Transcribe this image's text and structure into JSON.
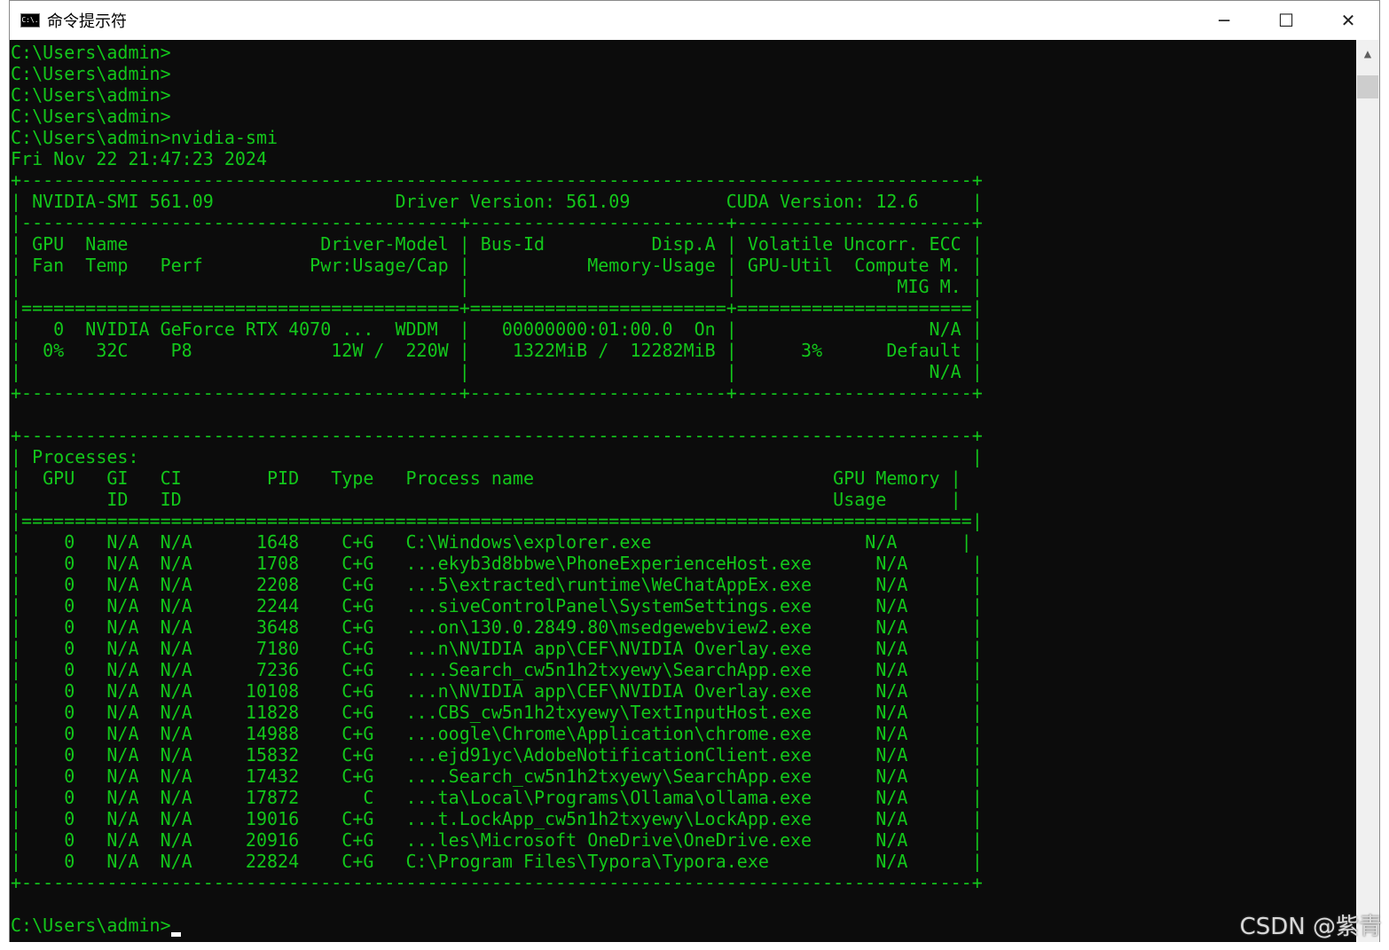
{
  "window": {
    "title": "命令提示符",
    "icon_text": "C:\\.",
    "minimize_glyph": "─",
    "maximize_glyph": "☐",
    "close_glyph": "✕"
  },
  "console": {
    "lines": [
      "C:\\Users\\admin>",
      "C:\\Users\\admin>",
      "C:\\Users\\admin>",
      "C:\\Users\\admin>",
      "C:\\Users\\admin>nvidia-smi",
      "Fri Nov 22 21:47:23 2024",
      "+-----------------------------------------------------------------------------------------+",
      "| NVIDIA-SMI 561.09                 Driver Version: 561.09         CUDA Version: 12.6     |",
      "|-----------------------------------------+------------------------+----------------------+",
      "| GPU  Name                  Driver-Model | Bus-Id          Disp.A | Volatile Uncorr. ECC |",
      "| Fan  Temp   Perf          Pwr:Usage/Cap |           Memory-Usage | GPU-Util  Compute M. |",
      "|                                         |                        |               MIG M. |",
      "|=========================================+========================+======================|",
      "|   0  NVIDIA GeForce RTX 4070 ...  WDDM  |   00000000:01:00.0  On |                  N/A |",
      "|  0%   32C    P8             12W /  220W |    1322MiB /  12282MiB |      3%      Default |",
      "|                                         |                        |                  N/A |",
      "+-----------------------------------------+------------------------+----------------------+",
      "",
      "+-----------------------------------------------------------------------------------------+",
      "| Processes:                                                                              |",
      "|  GPU   GI   CI        PID   Type   Process name                            GPU Memory |",
      "|        ID   ID                                                             Usage      |",
      "|=========================================================================================|",
      "|    0   N/A  N/A      1648    C+G   C:\\Windows\\explorer.exe                    N/A      |",
      "|    0   N/A  N/A      1708    C+G   ...ekyb3d8bbwe\\PhoneExperienceHost.exe      N/A      |",
      "|    0   N/A  N/A      2208    C+G   ...5\\extracted\\runtime\\WeChatAppEx.exe      N/A      |",
      "|    0   N/A  N/A      2244    C+G   ...siveControlPanel\\SystemSettings.exe      N/A      |",
      "|    0   N/A  N/A      3648    C+G   ...on\\130.0.2849.80\\msedgewebview2.exe      N/A      |",
      "|    0   N/A  N/A      7180    C+G   ...n\\NVIDIA app\\CEF\\NVIDIA Overlay.exe      N/A      |",
      "|    0   N/A  N/A      7236    C+G   ....Search_cw5n1h2txyewy\\SearchApp.exe      N/A      |",
      "|    0   N/A  N/A     10108    C+G   ...n\\NVIDIA app\\CEF\\NVIDIA Overlay.exe      N/A      |",
      "|    0   N/A  N/A     11828    C+G   ...CBS_cw5n1h2txyewy\\TextInputHost.exe      N/A      |",
      "|    0   N/A  N/A     14988    C+G   ...oogle\\Chrome\\Application\\chrome.exe      N/A      |",
      "|    0   N/A  N/A     15832    C+G   ...ejd91yc\\AdobeNotificationClient.exe      N/A      |",
      "|    0   N/A  N/A     17432    C+G   ....Search_cw5n1h2txyewy\\SearchApp.exe      N/A      |",
      "|    0   N/A  N/A     17872      C   ...ta\\Local\\Programs\\Ollama\\ollama.exe      N/A      |",
      "|    0   N/A  N/A     19016    C+G   ...t.LockApp_cw5n1h2txyewy\\LockApp.exe      N/A      |",
      "|    0   N/A  N/A     20916    C+G   ...les\\Microsoft OneDrive\\OneDrive.exe      N/A      |",
      "|    0   N/A  N/A     22824    C+G   C:\\Program Files\\Typora\\Typora.exe          N/A      |",
      "+-----------------------------------------------------------------------------------------+",
      ""
    ],
    "final_prompt": "C:\\Users\\admin>"
  },
  "scrollbar": {
    "up_arrow": "▲"
  },
  "watermark": "CSDN @紫青"
}
